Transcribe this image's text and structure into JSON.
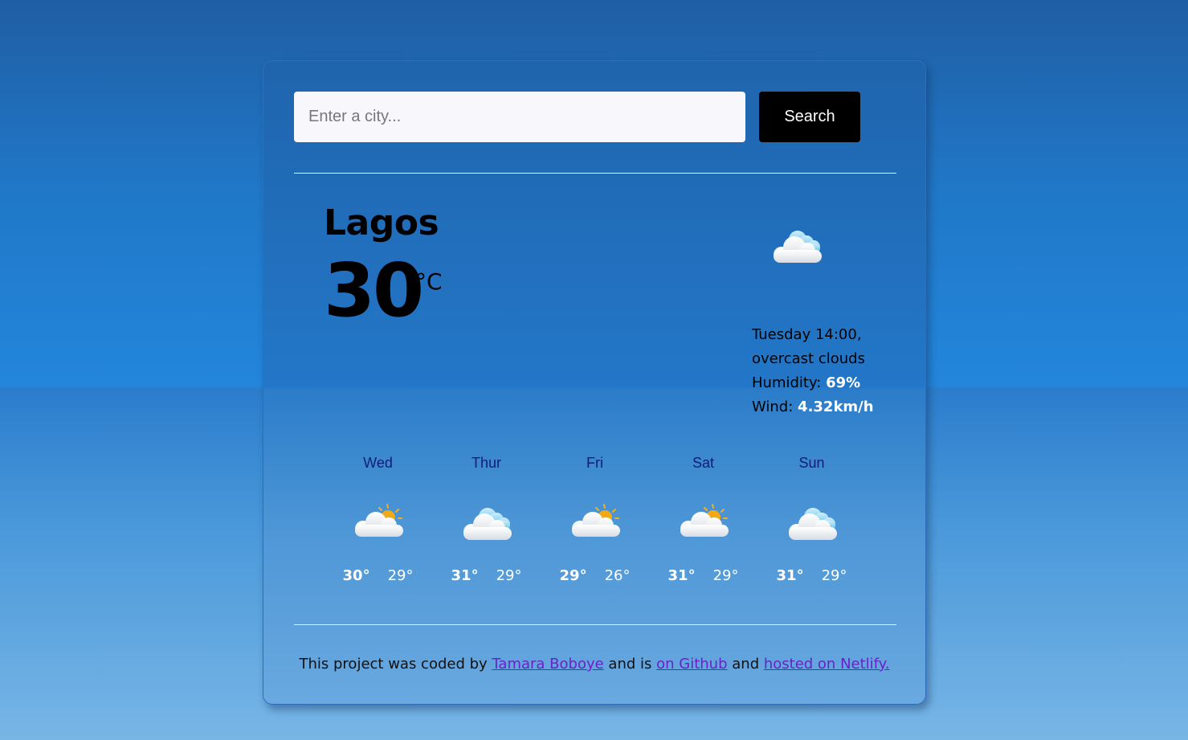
{
  "search": {
    "placeholder": "Enter a city...",
    "value": "",
    "button_label": "Search"
  },
  "current": {
    "city": "Lagos",
    "temperature": "30",
    "unit": "°C",
    "icon": "overcast-clouds-icon",
    "datetime": "Tuesday 14:00,",
    "description": "overcast clouds",
    "humidity_label": "Humidity:",
    "humidity_value": "69%",
    "wind_label": "Wind:",
    "wind_value": "4.32km/h"
  },
  "forecast": [
    {
      "day": "Wed",
      "icon": "sun-cloud-rain-icon",
      "max": "30°",
      "min": "29°"
    },
    {
      "day": "Thur",
      "icon": "clouds-icon",
      "max": "31°",
      "min": "29°"
    },
    {
      "day": "Fri",
      "icon": "sun-cloud-rain-icon",
      "max": "29°",
      "min": "26°"
    },
    {
      "day": "Sat",
      "icon": "sun-cloud-rain-icon",
      "max": "31°",
      "min": "29°"
    },
    {
      "day": "Sun",
      "icon": "clouds-icon",
      "max": "31°",
      "min": "29°"
    }
  ],
  "footer": {
    "text_1": "This project was coded by ",
    "author_link": "Tamara Boboye",
    "text_2": " and is ",
    "github_link": "on Github",
    "text_3": " and ",
    "netlify_link": "hosted on Netlify."
  },
  "colors": {
    "link": "#6a22c8",
    "day_label": "#0e1e7a",
    "button": "#000000"
  }
}
